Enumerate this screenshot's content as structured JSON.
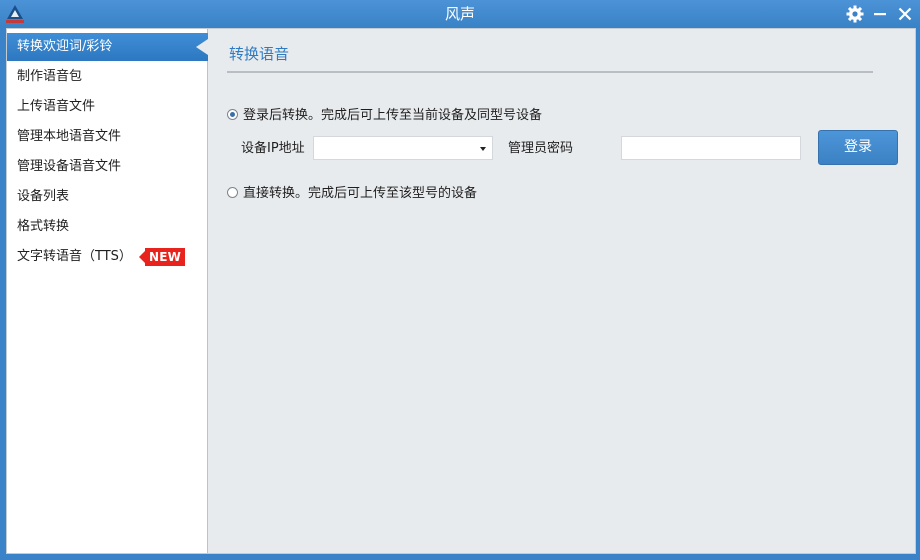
{
  "window": {
    "title": "风声"
  },
  "icons": {
    "app_logo": "app-logo-icon",
    "settings": "gear-icon",
    "minimize": "minimize-icon",
    "close": "close-icon"
  },
  "colors": {
    "accent": "#3b83c8",
    "active_item": "#3a86cf",
    "section_title": "#2e7bc4",
    "new_badge": "#e8221c",
    "panel_bg": "#e8ebed"
  },
  "sidebar": {
    "active_index": 0,
    "items": [
      {
        "label": "转换欢迎词/彩铃"
      },
      {
        "label": "制作语音包"
      },
      {
        "label": "上传语音文件"
      },
      {
        "label": "管理本地语音文件"
      },
      {
        "label": "管理设备语音文件"
      },
      {
        "label": "设备列表"
      },
      {
        "label": "格式转换"
      },
      {
        "label": "文字转语音（TTS）",
        "badge": "NEW"
      }
    ]
  },
  "main": {
    "section_title": "转换语音",
    "option_login": {
      "label": "登录后转换。完成后可上传至当前设备及同型号设备",
      "checked": true
    },
    "ip_label": "设备IP地址",
    "ip_value": "",
    "password_label": "管理员密码",
    "password_value": "",
    "login_button": "登录",
    "option_direct": {
      "label": "直接转换。完成后可上传至该型号的设备",
      "checked": false
    }
  }
}
